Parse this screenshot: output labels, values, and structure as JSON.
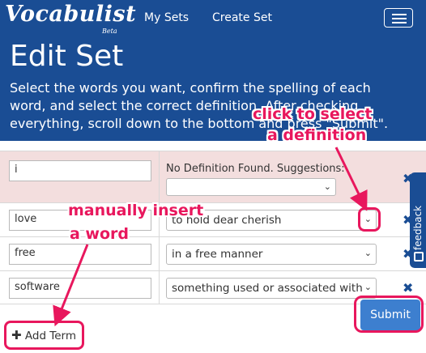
{
  "app": {
    "brand": "Vocabulist",
    "brand_sub": "Beta",
    "nav": [
      "My Sets",
      "Create Set"
    ]
  },
  "page": {
    "title": "Edit Set",
    "instructions": [
      "Select the words you want, confirm the spelling of each",
      "word, and select the correct definition. After checking",
      "everything, scroll down to the bottom and press \"Submit\"."
    ]
  },
  "terms": [
    {
      "term": "i",
      "no_definition_label": "No Definition Found. Suggestions:",
      "definition": ""
    },
    {
      "term": "love",
      "definition": "to hold dear cherish"
    },
    {
      "term": "free",
      "definition": "in a free manner"
    },
    {
      "term": "software",
      "definition": "something used or associated with"
    }
  ],
  "actions": {
    "add_term": "Add Term",
    "submit": "Submit",
    "feedback": "feedback"
  },
  "annotations": {
    "select_definition": [
      "click to select",
      "a definition"
    ],
    "insert_word": [
      "manually insert",
      "a word"
    ]
  },
  "colors": {
    "navbar": "#1a4d94",
    "submit": "#3d7fcf",
    "warning_row": "#f3dede",
    "annotation": "#e8175d"
  }
}
